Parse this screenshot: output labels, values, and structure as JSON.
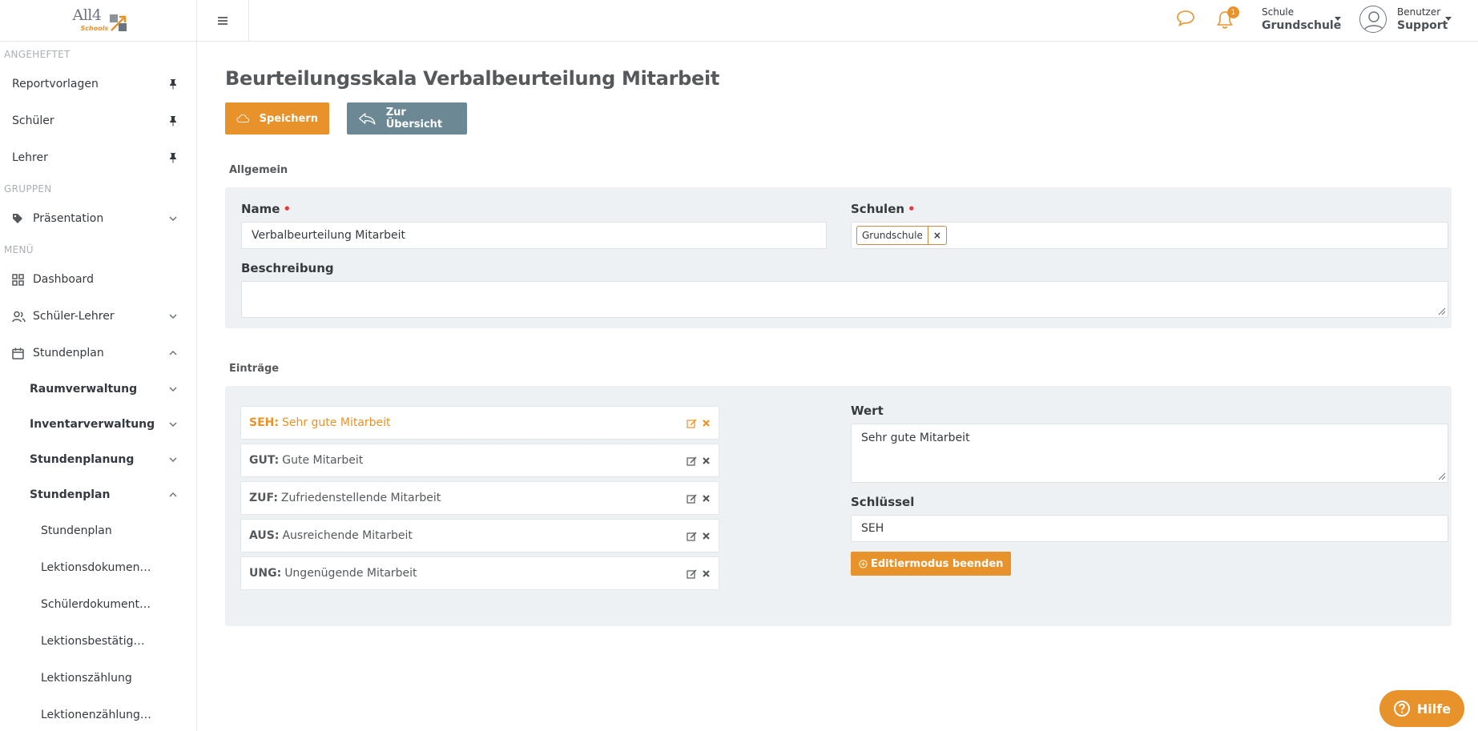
{
  "brand": {
    "logo_main": "All4",
    "logo_sub": "Schools"
  },
  "sidebar": {
    "pinned_title": "ANGEHEFTET",
    "pinned": [
      "Reportvorlagen",
      "Schüler",
      "Lehrer"
    ],
    "groups_title": "GRUPPEN",
    "groups": [
      "Präsentation"
    ],
    "menu_title": "MENÜ",
    "menu": {
      "dashboard": "Dashboard",
      "schueler_lehrer": "Schüler-Lehrer",
      "stundenplan": "Stundenplan",
      "raumverwaltung": "Raumverwaltung",
      "inventarverwaltung": "Inventarverwaltung",
      "stundenplanung": "Stundenplanung",
      "stundenplan_sub": "Stundenplan",
      "items": [
        "Stundenplan",
        "Lektionsdokument…",
        "Schülerdokument…",
        "Lektionsbestätigu…",
        "Lektionszählung",
        "Lektionenzählung …"
      ]
    }
  },
  "topbar": {
    "notification_count": "1",
    "school_label": "Schule",
    "school_value": "Grundschule",
    "user_label": "Benutzer",
    "user_value": "Support"
  },
  "page": {
    "title": "Beurteilungsskala Verbalbeurteilung Mitarbeit",
    "save_label": "Speichern",
    "back_label": "Zur Übersicht",
    "section_general": "Allgemein",
    "name_label": "Name",
    "name_value": "Verbalbeurteilung Mitarbeit",
    "schools_label": "Schulen",
    "school_tag": "Grundschule",
    "school_tag_remove": "×",
    "description_label": "Beschreibung",
    "description_value": "",
    "section_entries": "Einträge",
    "entries": [
      {
        "key": "SEH:",
        "text": "Sehr gute Mitarbeit",
        "active": true
      },
      {
        "key": "GUT:",
        "text": "Gute Mitarbeit",
        "active": false
      },
      {
        "key": "ZUF:",
        "text": "Zufriedenstellende Mitarbeit",
        "active": false
      },
      {
        "key": "AUS:",
        "text": "Ausreichende Mitarbeit",
        "active": false
      },
      {
        "key": "UNG:",
        "text": "Ungenügende Mitarbeit",
        "active": false
      }
    ],
    "wert_label": "Wert",
    "wert_value": "Sehr gute Mitarbeit",
    "key_label": "Schlüssel",
    "key_value": "SEH",
    "edit_end_label": "Editiermodus beenden"
  },
  "help": {
    "label": "Hilfe"
  },
  "colors": {
    "accent": "#e8922b",
    "secondary": "#6c8894",
    "panel": "#eef1f3",
    "required": "#e53935"
  }
}
